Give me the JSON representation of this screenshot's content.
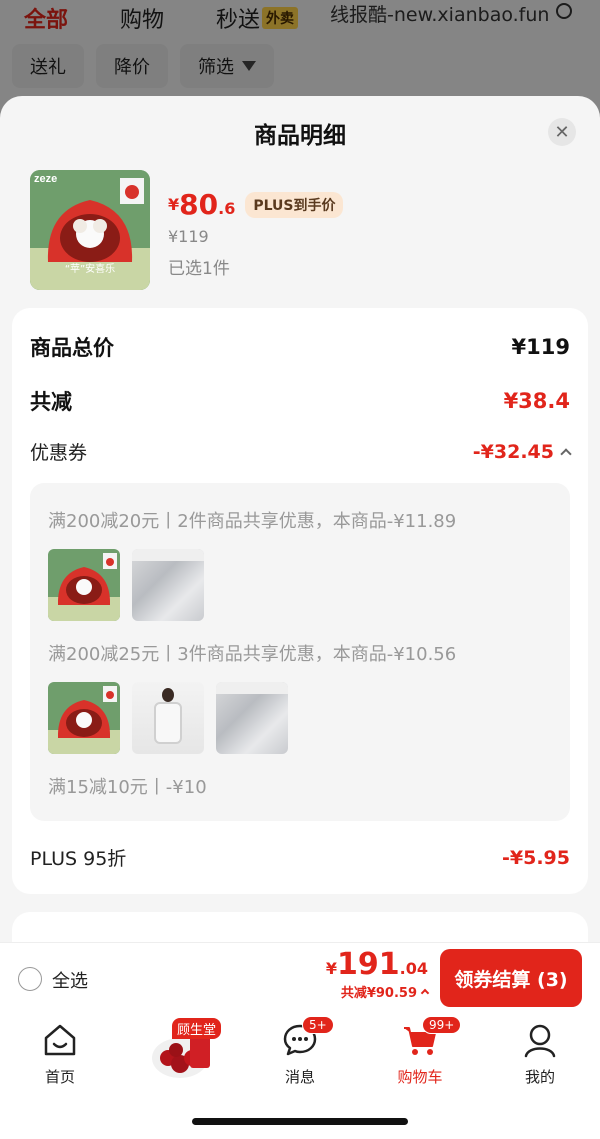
{
  "background": {
    "tabs": [
      {
        "label": "全部",
        "active": true
      },
      {
        "label": "购物",
        "active": false
      },
      {
        "label": "秒送",
        "active": false,
        "badge": "外卖"
      }
    ],
    "watermark": "线报酷-new.xianbao.fun",
    "filters": [
      "送礼",
      "降价",
      "筛选"
    ]
  },
  "sheet": {
    "title": "商品明细",
    "product": {
      "brand": "zeze",
      "badge_text": "“苹”安喜乐",
      "price_currency": "¥",
      "price_int": "80",
      "price_dec": ".6",
      "plus_tag": "PLUS到手价",
      "original_price": "¥119",
      "selected": "已选1件"
    },
    "summary": {
      "total_label": "商品总价",
      "total_value": "¥119",
      "reduce_label": "共减",
      "reduce_value": "¥38.4",
      "coupon_label": "优惠券",
      "coupon_value": "-¥32.45",
      "plus_label": "PLUS 95折",
      "plus_value": "-¥5.95"
    },
    "coupons": [
      {
        "text": "满200减20元丨2件商品共享优惠，本商品-¥11.89"
      },
      {
        "text": "满200减25元丨3件商品共享优惠，本商品-¥10.56"
      },
      {
        "text": "满15减10元丨-¥10"
      }
    ]
  },
  "checkout": {
    "select_all": "全选",
    "currency": "¥",
    "total_int": "191",
    "total_dec": ".04",
    "saved": "共减¥90.59",
    "button": "领券结算 (3)"
  },
  "nav": {
    "home": "首页",
    "promo_tag": "顾生堂",
    "messages": "消息",
    "messages_badge": "5+",
    "cart": "购物车",
    "cart_badge": "99+",
    "mine": "我的"
  },
  "colors": {
    "accent": "#e1251b",
    "plus_tag_bg": "#fbe6d2"
  }
}
